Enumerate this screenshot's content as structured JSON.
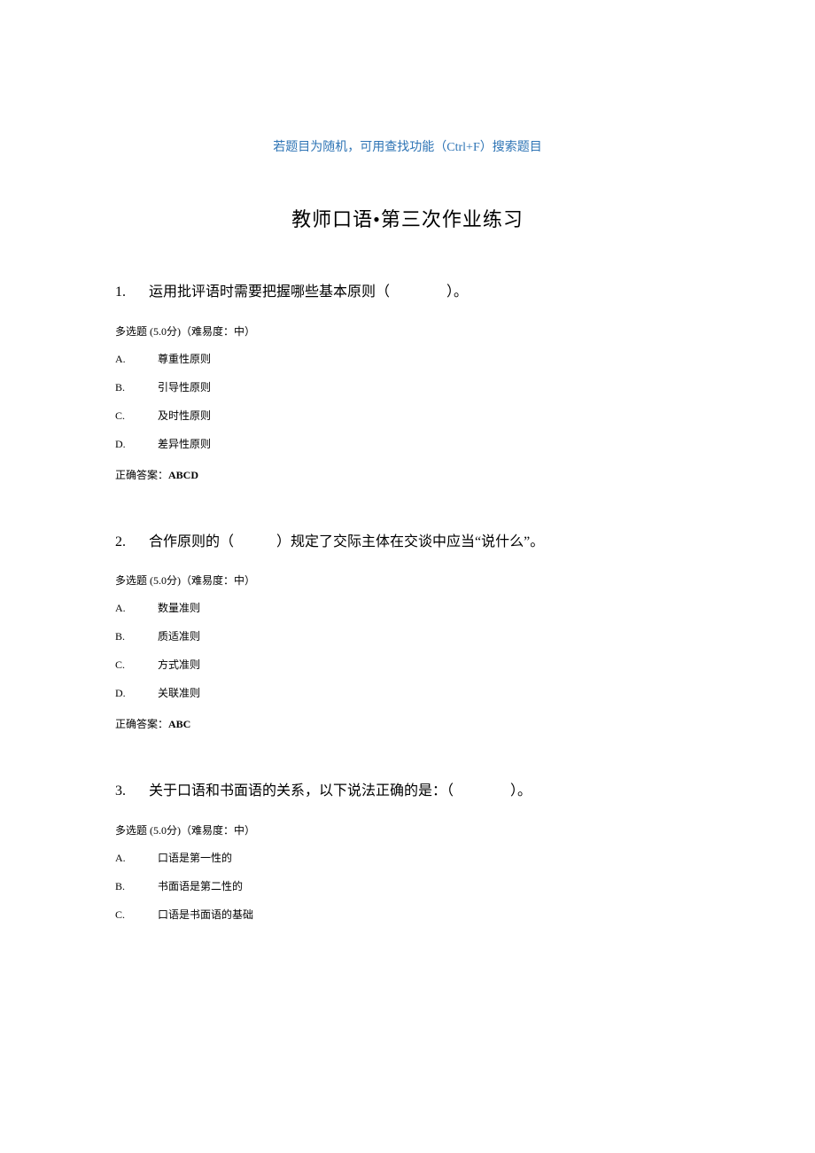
{
  "hint": "若题目为随机，可用查找功能（Ctrl+F）搜索题目",
  "title": "教师口语•第三次作业练习",
  "meta_template": {
    "type_text": "多选题 (5.0分)",
    "difficulty_text": "（难易度：中）"
  },
  "answer_label": "正确答案：",
  "questions": [
    {
      "num": "1.",
      "stem": "运用批评语时需要把握哪些基本原则（　　　　）。",
      "options": [
        {
          "letter": "A.",
          "text": "尊重性原则"
        },
        {
          "letter": "B.",
          "text": "引导性原则"
        },
        {
          "letter": "C.",
          "text": "及时性原则"
        },
        {
          "letter": "D.",
          "text": "差异性原则"
        }
      ],
      "answer": "ABCD"
    },
    {
      "num": "2.",
      "stem": "合作原则的（　　　）规定了交际主体在交谈中应当“说什么”。",
      "options": [
        {
          "letter": "A.",
          "text": "数量准则"
        },
        {
          "letter": "B.",
          "text": "质适准则"
        },
        {
          "letter": "C.",
          "text": "方式准则"
        },
        {
          "letter": "D.",
          "text": "关联准则"
        }
      ],
      "answer": "ABC"
    },
    {
      "num": "3.",
      "stem": "关于口语和书面语的关系，以下说法正确的是：（　　　　）。",
      "options": [
        {
          "letter": "A.",
          "text": "口语是第一性的"
        },
        {
          "letter": "B.",
          "text": "书面语是第二性的"
        },
        {
          "letter": "C.",
          "text": "口语是书面语的基础"
        }
      ],
      "answer": null
    }
  ]
}
